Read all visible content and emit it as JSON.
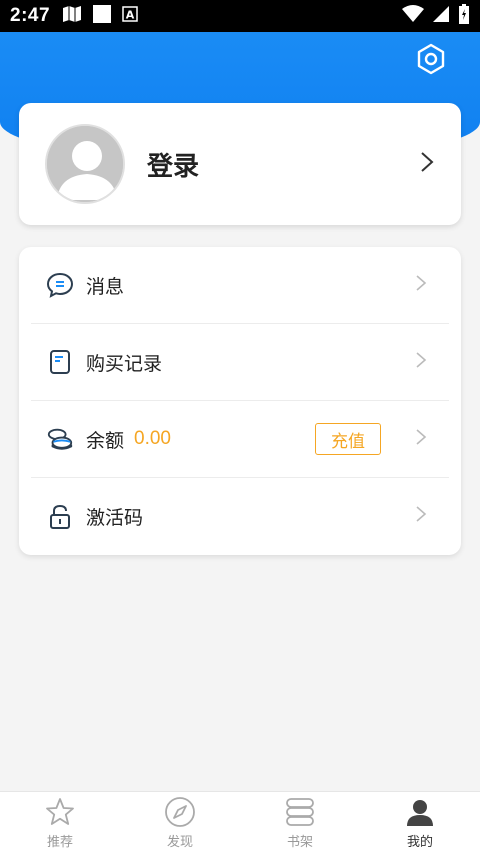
{
  "status_bar": {
    "time": "2:47",
    "left_icons": [
      "map-icon",
      "square-icon",
      "a-box-icon"
    ],
    "right_icons": [
      "wifi-icon",
      "signal-icon",
      "battery-icon"
    ]
  },
  "header": {
    "settings_icon": "settings-hexagon-icon",
    "accent_color": "#1a8cf5"
  },
  "profile": {
    "login_label": "登录",
    "avatar_icon": "default-avatar-icon"
  },
  "menu": {
    "messages_label": "消息",
    "purchase_label": "购买记录",
    "balance_label": "余额",
    "balance_value": "0.00",
    "recharge_label": "充值",
    "activation_label": "激活码",
    "accent_orange": "#f5a623"
  },
  "bottom_nav": {
    "items": [
      {
        "label": "推荐",
        "icon": "star-icon",
        "active": false
      },
      {
        "label": "发现",
        "icon": "compass-icon",
        "active": false
      },
      {
        "label": "书架",
        "icon": "bookshelf-icon",
        "active": false
      },
      {
        "label": "我的",
        "icon": "person-icon",
        "active": true
      }
    ]
  }
}
